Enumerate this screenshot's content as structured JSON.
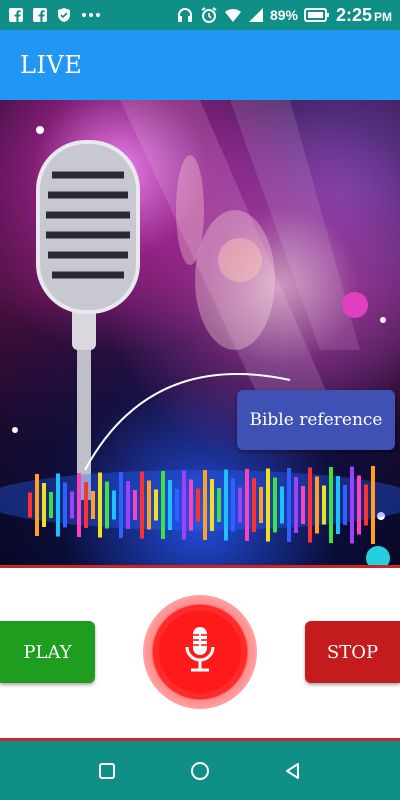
{
  "status_bar": {
    "battery_percent": "89%",
    "time": "2:25",
    "ampm": "PM",
    "icons": [
      "facebook-icon",
      "facebook-icon",
      "shield-icon",
      "more-dots-icon",
      "headphones-icon",
      "alarm-icon",
      "wifi-icon",
      "signal-icon",
      "battery-icon"
    ]
  },
  "app_bar": {
    "title": "LIVE"
  },
  "hero": {
    "image": "concert-microphone-equalizer-background",
    "bible_reference_label": "Bible reference"
  },
  "controls": {
    "play_label": "PLAY",
    "stop_label": "STOP",
    "mic_icon": "microphone-icon"
  },
  "nav_bar": {
    "icons": [
      "recents-square-icon",
      "home-circle-icon",
      "back-triangle-icon"
    ]
  },
  "colors": {
    "status_bar": "#0f8f86",
    "app_bar": "#2196f3",
    "bible_button": "#3f51b5",
    "play_button": "#1e9d1e",
    "stop_button": "#c41c1c",
    "mic_button": "#ff1a1a",
    "divider": "#c62828"
  }
}
